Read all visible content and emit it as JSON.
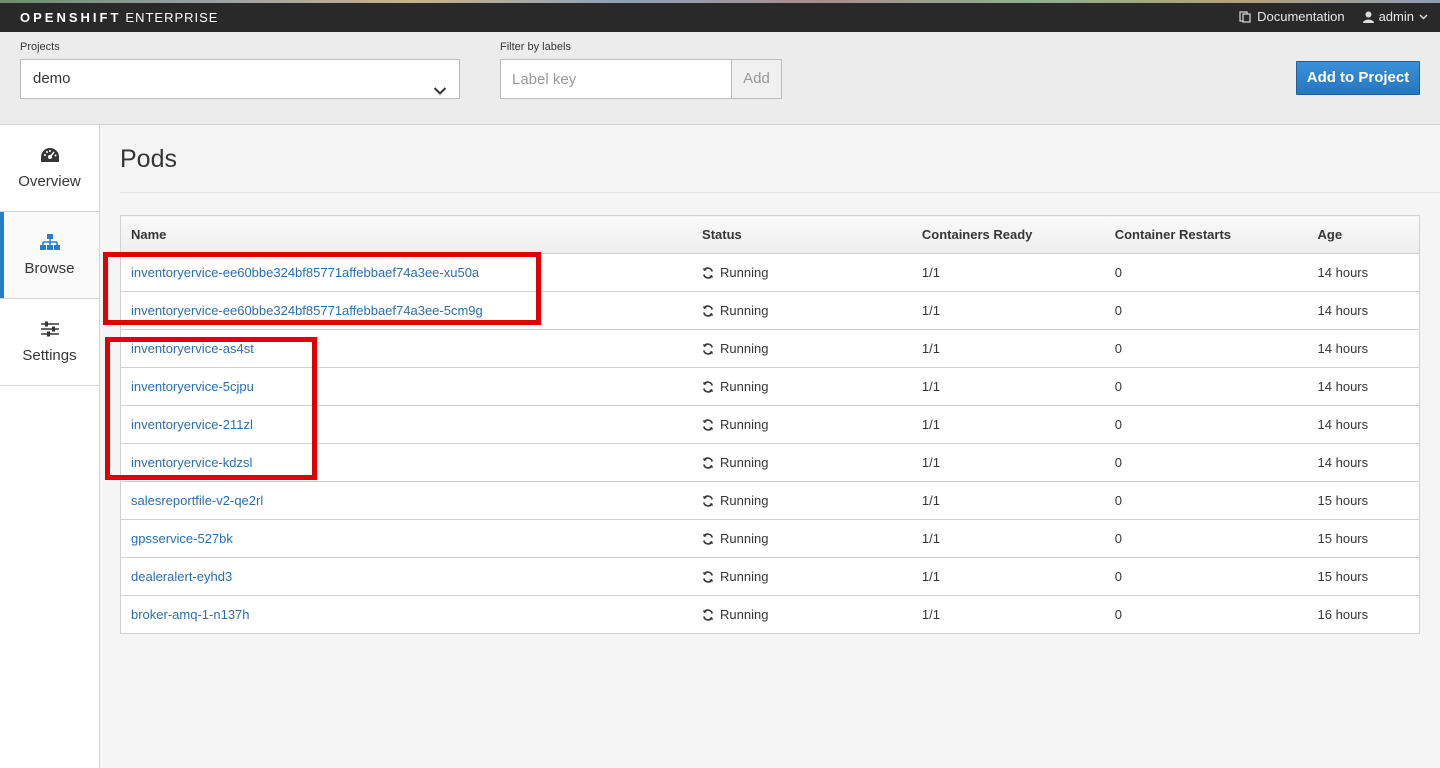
{
  "topbar": {
    "brand_bold": "OPENSHIFT",
    "brand_light": "ENTERPRISE",
    "documentation": "Documentation",
    "user": "admin"
  },
  "header": {
    "projects_label": "Projects",
    "project_value": "demo",
    "filter_label": "Filter by labels",
    "label_key_placeholder": "Label key",
    "add_label": "Add",
    "add_to_project": "Add to Project"
  },
  "sidenav": {
    "items": [
      {
        "label": "Overview",
        "icon": "dashboard-icon",
        "active": false
      },
      {
        "label": "Browse",
        "icon": "sitemap-icon",
        "active": true
      },
      {
        "label": "Settings",
        "icon": "sliders-icon",
        "active": false
      }
    ]
  },
  "page": {
    "title": "Pods"
  },
  "table": {
    "columns": [
      "Name",
      "Status",
      "Containers Ready",
      "Container Restarts",
      "Age"
    ],
    "rows": [
      {
        "name": "inventoryervice-ee60bbe324bf85771affebbaef74a3ee-xu50a",
        "status": "Running",
        "ready": "1/1",
        "restarts": "0",
        "age": "14 hours"
      },
      {
        "name": "inventoryervice-ee60bbe324bf85771affebbaef74a3ee-5cm9g",
        "status": "Running",
        "ready": "1/1",
        "restarts": "0",
        "age": "14 hours"
      },
      {
        "name": "inventoryervice-as4st",
        "status": "Running",
        "ready": "1/1",
        "restarts": "0",
        "age": "14 hours"
      },
      {
        "name": "inventoryervice-5cjpu",
        "status": "Running",
        "ready": "1/1",
        "restarts": "0",
        "age": "14 hours"
      },
      {
        "name": "inventoryervice-211zl",
        "status": "Running",
        "ready": "1/1",
        "restarts": "0",
        "age": "14 hours"
      },
      {
        "name": "inventoryervice-kdzsl",
        "status": "Running",
        "ready": "1/1",
        "restarts": "0",
        "age": "14 hours"
      },
      {
        "name": "salesreportfile-v2-qe2rl",
        "status": "Running",
        "ready": "1/1",
        "restarts": "0",
        "age": "15 hours"
      },
      {
        "name": "gpsservice-527bk",
        "status": "Running",
        "ready": "1/1",
        "restarts": "0",
        "age": "15 hours"
      },
      {
        "name": "dealeralert-eyhd3",
        "status": "Running",
        "ready": "1/1",
        "restarts": "0",
        "age": "15 hours"
      },
      {
        "name": "broker-amq-1-n137h",
        "status": "Running",
        "ready": "1/1",
        "restarts": "0",
        "age": "16 hours"
      }
    ]
  },
  "colors": {
    "accent": "#2a7fc9",
    "link": "#2a6fb0",
    "highlight": "#e00000",
    "topbar": "#292929"
  }
}
